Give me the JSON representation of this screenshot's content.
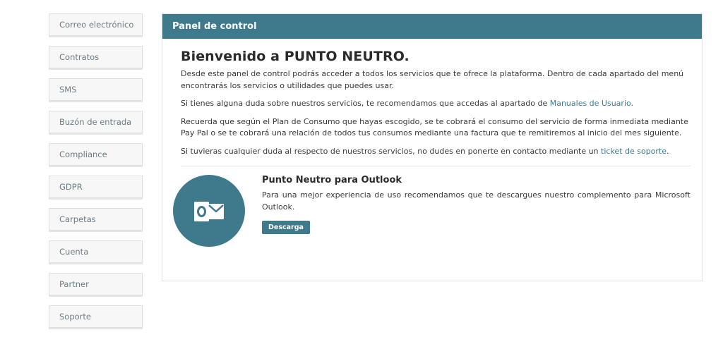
{
  "sidebar": {
    "items": [
      {
        "label": "Correo electrónico"
      },
      {
        "label": "Contratos"
      },
      {
        "label": "SMS"
      },
      {
        "label": "Buzón de entrada"
      },
      {
        "label": "Compliance"
      },
      {
        "label": "GDPR"
      },
      {
        "label": "Carpetas"
      },
      {
        "label": "Cuenta"
      },
      {
        "label": "Partner"
      },
      {
        "label": "Soporte"
      }
    ]
  },
  "panel": {
    "header": "Panel de control",
    "welcome_title": "Bienvenido a PUNTO NEUTRO.",
    "paragraph1": "Desde este panel de control podrás acceder a todos los servicios que te ofrece la plataforma. Dentro de cada apartado del menú encontrarás los servicios o utilidades que puedes usar.",
    "paragraph2_prefix": "Si tienes alguna duda sobre nuestros servicios, te recomendamos que accedas al apartado de ",
    "paragraph2_link": "Manuales de Usuario",
    "paragraph2_suffix": ".",
    "paragraph3": "Recuerda que según el Plan de Consumo que hayas escogido, se te cobrará el consumo del servicio de forma inmediata mediante Pay Pal o se te cobrará una relación de todos tus consumos mediante una factura que te remitiremos al inicio del mes siguiente.",
    "paragraph4_prefix": "Si tuvieras cualquier duda al respecto de nuestros servicios, no dudes en ponerte en contacto mediante un ",
    "paragraph4_link": "ticket de soporte",
    "paragraph4_suffix": "."
  },
  "outlook": {
    "icon": "outlook-icon",
    "title": "Punto Neutro para Outlook",
    "description": "Para una mejor experiencia de uso recomendamos que te descargues nuestro complemento para Microsoft Outlook.",
    "button_label": "Descarga"
  },
  "colors": {
    "accent": "#3e7a8c",
    "sidebar_bg": "#f7f7f7",
    "sidebar_text": "#6b7c85"
  }
}
